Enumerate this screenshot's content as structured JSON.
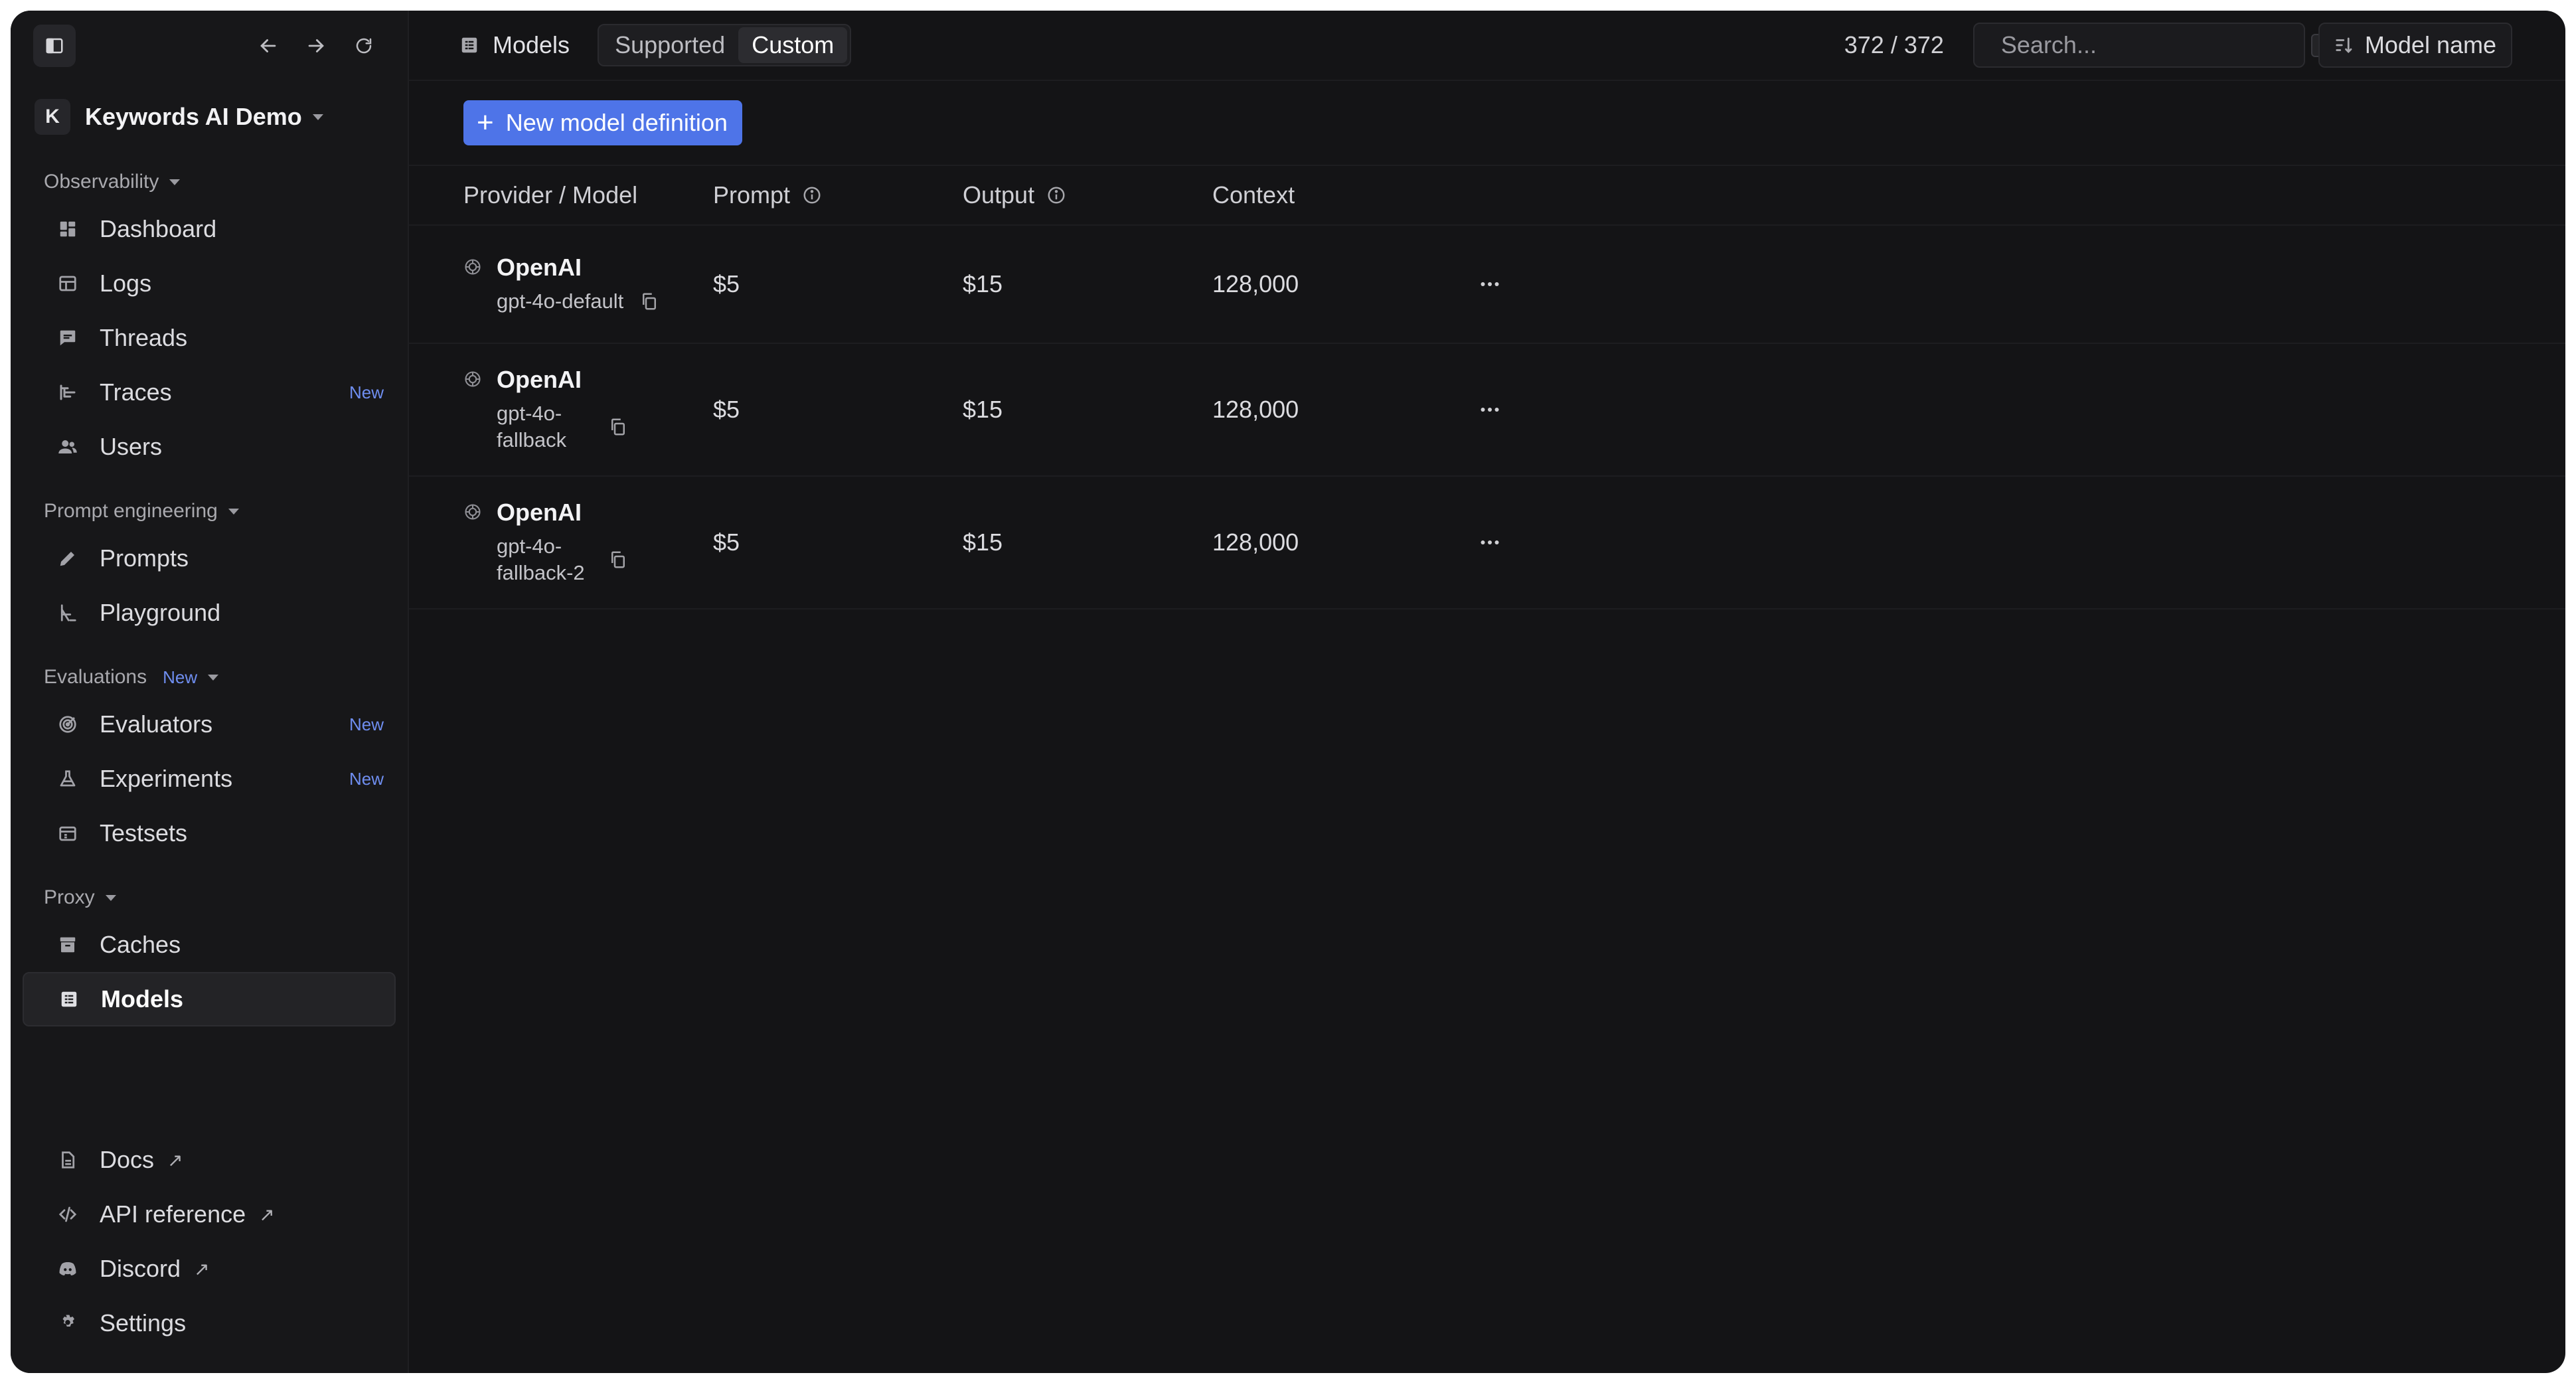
{
  "sidebar": {
    "workspace": {
      "initial": "K",
      "name": "Keywords AI Demo"
    },
    "sections": {
      "observability": {
        "label": "Observability",
        "items": [
          {
            "label": "Dashboard",
            "icon": "dashboard-icon"
          },
          {
            "label": "Logs",
            "icon": "table-icon"
          },
          {
            "label": "Threads",
            "icon": "chat-icon"
          },
          {
            "label": "Traces",
            "icon": "traces-icon",
            "badge": "New"
          },
          {
            "label": "Users",
            "icon": "users-icon"
          }
        ]
      },
      "prompt_engineering": {
        "label": "Prompt engineering",
        "items": [
          {
            "label": "Prompts",
            "icon": "pencil-icon"
          },
          {
            "label": "Playground",
            "icon": "playground-icon"
          }
        ]
      },
      "evaluations": {
        "label": "Evaluations",
        "badge": "New",
        "items": [
          {
            "label": "Evaluators",
            "icon": "target-icon",
            "badge": "New"
          },
          {
            "label": "Experiments",
            "icon": "flask-icon",
            "badge": "New"
          },
          {
            "label": "Testsets",
            "icon": "testset-icon"
          }
        ]
      },
      "proxy": {
        "label": "Proxy",
        "items": [
          {
            "label": "Caches",
            "icon": "archive-icon"
          },
          {
            "label": "Models",
            "icon": "models-icon"
          }
        ]
      }
    },
    "bottom": {
      "docs": "Docs",
      "api_reference": "API reference",
      "discord": "Discord",
      "settings": "Settings"
    }
  },
  "header": {
    "page": "Models",
    "segments": [
      "Supported",
      "Custom"
    ],
    "selected_segment": "Custom",
    "count": "372 / 372",
    "search_placeholder": "Search...",
    "search_shortcut": "/",
    "sort_label": "Model name"
  },
  "actions": {
    "new_model": "New model definition"
  },
  "table": {
    "columns": {
      "provider": "Provider / Model",
      "prompt": "Prompt",
      "output": "Output",
      "context": "Context"
    },
    "rows": [
      {
        "provider": "OpenAI",
        "model": "gpt-4o-default",
        "prompt": "$5",
        "output": "$15",
        "context": "128,000"
      },
      {
        "provider": "OpenAI",
        "model": "gpt-4o-fallback",
        "model_lines": [
          "gpt-4o-",
          "fallback"
        ],
        "prompt": "$5",
        "output": "$15",
        "context": "128,000"
      },
      {
        "provider": "OpenAI",
        "model": "gpt-4o-fallback-2",
        "model_lines": [
          "gpt-4o-",
          "fallback-2"
        ],
        "prompt": "$5",
        "output": "$15",
        "context": "128,000"
      }
    ]
  }
}
